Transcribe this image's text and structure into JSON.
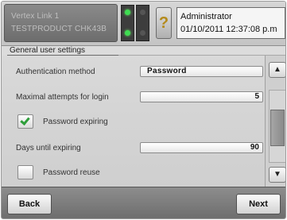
{
  "header": {
    "device_line1": "Vertex Link 1",
    "device_line2": "TESTPRODUCT CHK43B",
    "help_label": "?",
    "user_name": "Administrator",
    "datetime": "01/10/2011 12:37:08 p.m"
  },
  "section": {
    "title": "General user settings"
  },
  "settings": {
    "auth_method_label": "Authentication method",
    "auth_method_value": "Password",
    "max_attempts_label": "Maximal attempts for login",
    "max_attempts_value": "5",
    "password_expiring_label": "Password expiring",
    "password_expiring_checked": true,
    "days_until_expiring_label": "Days until expiring",
    "days_until_expiring_value": "90",
    "password_reuse_label": "Password reuse",
    "password_reuse_checked": false
  },
  "scrollbar": {
    "up_arrow": "▲",
    "down_arrow": "▼",
    "thumb_position": 0.55
  },
  "footer": {
    "back_label": "Back",
    "next_label": "Next"
  },
  "colors": {
    "check_green": "#2e9e3a",
    "led_green": "#3fdc52"
  },
  "icons": {
    "help": "help-question-icon",
    "up": "arrow-up-icon",
    "down": "arrow-down-icon"
  }
}
